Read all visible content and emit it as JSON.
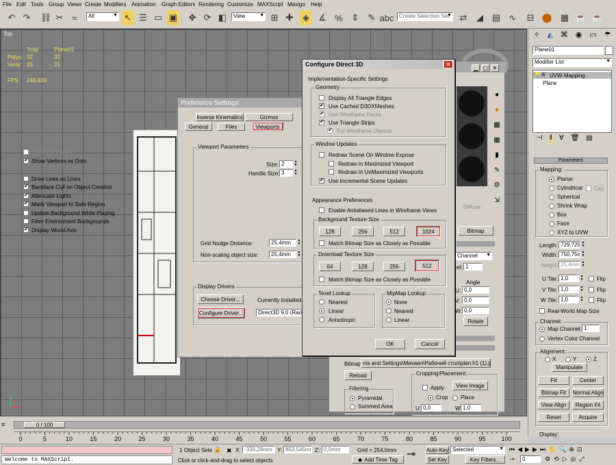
{
  "menu": [
    "File",
    "Edit",
    "Tools",
    "Group",
    "Views",
    "Create",
    "Modifiers",
    "Animation",
    "Graph Editors",
    "Rendering",
    "Customize",
    "MAXScript",
    "Maxigo",
    "Help"
  ],
  "toolbar": {
    "filter": "All",
    "view": "View",
    "selection_set": "Create Selection Set"
  },
  "viewport": {
    "label": "Top",
    "stats_headers": [
      "Total",
      "Plane01"
    ],
    "stats_rows": [
      [
        "Polys:",
        "32",
        "32"
      ],
      [
        "Verts:",
        "25",
        "25"
      ]
    ],
    "fps_label": "FPS:",
    "fps_value": "248.839"
  },
  "pref": {
    "title": "Preference Settings",
    "tabs_row1": [
      "Inverse Kinematics",
      "Gizmos"
    ],
    "tabs_row2": [
      "General",
      "Files",
      "Viewports"
    ],
    "vp_group": "Viewport Parameters",
    "options": [
      {
        "label": "Use Dual Planes",
        "checked": false,
        "disabled": true
      },
      {
        "label": "Show Vertices as Dots",
        "checked": true
      },
      {
        "label": "Draw Links as Lines",
        "checked": false
      },
      {
        "label": "Backface Cull on Object Creation",
        "checked": true
      },
      {
        "label": "Attenuate Lights",
        "checked": true
      },
      {
        "label": "Mask Viewport to Safe Region",
        "checked": true
      },
      {
        "label": "Update Background While Playing",
        "checked": false
      },
      {
        "label": "Filter Environment Backgrounds",
        "checked": false
      },
      {
        "label": "Display World Axis",
        "checked": true
      }
    ],
    "size_label": "Size:",
    "size_value": "2",
    "handle_label": "Handle Size:",
    "handle_value": "3",
    "grid_nudge_label": "Grid Nudge Distance:",
    "grid_nudge_value": "25,4mm",
    "nonscale_label": "Non-scaling object size:",
    "nonscale_value": "25,4mm",
    "drivers_group": "Display Drivers",
    "choose_driver": "Choose Driver...",
    "configure_driver": "Configure Driver...",
    "installed_label": "Currently Installed D",
    "installed_value": "Direct3D 9.0 (Rade"
  },
  "d3d": {
    "title": "Configure Direct 3D",
    "impl_group": "Implementation-Specific Settings",
    "geometry_group": "Geometry",
    "geometry": [
      {
        "label": "Display All Triangle Edges",
        "checked": false
      },
      {
        "label": "Use Cached D3DXMeshes",
        "checked": true
      },
      {
        "label": "Use Wireframe Faces",
        "checked": true,
        "disabled": true
      },
      {
        "label": "Use Triangle Strips",
        "checked": true
      },
      {
        "label": "For Wireframe Objects",
        "checked": true,
        "disabled": true
      }
    ],
    "window_group": "Window Updates",
    "window": [
      {
        "label": "Redraw Scene On Window Expose",
        "checked": false
      },
      {
        "label": "Redraw In Maximized Viewport",
        "checked": false
      },
      {
        "label": "Redraw In UnMaximized Viewports",
        "checked": false
      },
      {
        "label": "Use Incremental Scene Updates",
        "checked": true
      }
    ],
    "appearance_group": "Appearance Preferences",
    "antialias": "Enable Antialiased Lines in Wireframe Views",
    "bg_texture_group": "Background Texture Size",
    "bg_sizes": [
      "128",
      "256",
      "512",
      "1024"
    ],
    "bg_match": "Match Bitmap Size as Closely as Possible",
    "dl_texture_group": "Download Texture Size",
    "dl_sizes": [
      "64",
      "128",
      "256",
      "512"
    ],
    "dl_match": "Match Bitmap Size as Closely as Possible",
    "texel_group": "Texel Lookup",
    "texel": [
      "Nearest",
      "Linear",
      "Anisotropic"
    ],
    "texel_selected": 1,
    "mipmap_group": "MipMap Lookup",
    "mipmap": [
      "None",
      "Nearest",
      "Linear"
    ],
    "mipmap_selected": 0,
    "ok": "OK",
    "cancel": "Cancel"
  },
  "mat": {
    "diffuse": "Diffuse:",
    "bitmap": "Bitmap",
    "channel": "Channel",
    "et": "et:",
    "et_value": "1",
    "angle": "Angle",
    "u": "U:",
    "v": "V:",
    "w": "W:",
    "val": "0,0",
    "rotate": "Rotate",
    "bitmap_path_label": "Bitmap:",
    "bitmap_path": "nts and Settings\\Михаил\\Рабочий стол\\plan.h1 (1).jpg",
    "reload": "Reload",
    "cropping": "Cropping/Placement",
    "apply": "Apply",
    "view_image": "View Image",
    "crop": "Crop",
    "place": "Place",
    "filtering": "Filtering",
    "pyramidal": "Pyramidal",
    "summed": "Summed Area",
    "u_small": "U:",
    "u_val": "0,0",
    "w_small": "W:",
    "w_val": "1,0"
  },
  "panel": {
    "object_name": "Plane01",
    "modifier_list": "Modifier List",
    "stack": [
      "UVW Mapping",
      "Plane"
    ],
    "parameters": "Parameters",
    "mapping_label": "Mapping:",
    "mapping": [
      "Planar",
      "Cylindrical",
      "Spherical",
      "Shrink Wrap",
      "Box",
      "Face",
      "XYZ to UVW"
    ],
    "cap": "Cap",
    "length_label": "Length:",
    "length": "729,729",
    "width_label": "Width:",
    "width": "750,75m",
    "height_label": "Height:",
    "height": "25,4mm",
    "utile_label": "U Tile:",
    "utile": "1,0",
    "vtile_label": "V Tile:",
    "vtile": "1,0",
    "wtile_label": "W Tile:",
    "wtile": "1,0",
    "flip": "Flip",
    "realworld": "Real-World Map Size",
    "channel_label": "Channel:",
    "map_channel": "Map Channel:",
    "map_channel_value": "1",
    "vertex_color": "Vertex Color Channel",
    "alignment_label": "Alignment:",
    "axes": [
      "X",
      "Y",
      "Z"
    ],
    "manipulate": "Manipulate",
    "fit": "Fit",
    "center": "Center",
    "bitmap_fit": "Bitmap Fit",
    "normal_align": "Normal Align",
    "view_align": "View Align",
    "region_fit": "Region Fit",
    "reset": "Reset",
    "acquire": "Acquire",
    "display_label": "Display:"
  },
  "timeline": {
    "slider": "0 / 100",
    "ticks": [
      "0",
      "5",
      "10",
      "15",
      "20",
      "25",
      "30",
      "35",
      "40",
      "45",
      "50",
      "55",
      "60",
      "65",
      "70",
      "75",
      "80",
      "85",
      "90",
      "95",
      "100"
    ]
  },
  "status": {
    "maxscript": "Welcome to MAXScript.",
    "selected": "1 Object Sele",
    "x_label": "X:",
    "x": "-339,28mm",
    "y_label": "Y:",
    "y": "863,546mm",
    "z_label": "Z:",
    "z": "0,0mm",
    "grid": "Grid = 254,0mm",
    "prompt": "Click or click-and-drag to select objects",
    "add_time_tag": "Add Time Tag",
    "auto_key": "Auto Key",
    "set_key": "Set Key",
    "selected_dd": "Selected",
    "key_filters": "Key Filters...",
    "frame": "0"
  }
}
